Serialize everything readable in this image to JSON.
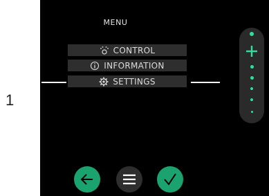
{
  "callout": {
    "number": "1"
  },
  "menu": {
    "title": "MENU",
    "items": [
      {
        "label": "CONTROL",
        "icon": "control-icon"
      },
      {
        "label": "INFORMATION",
        "icon": "info-icon"
      },
      {
        "label": "SETTINGS",
        "icon": "gear-icon",
        "selected": true
      }
    ]
  },
  "side_control": {
    "icons": [
      "dot-icon",
      "plus-icon",
      "dot-icon",
      "dot-icon",
      "dot-icon",
      "dot-icon",
      "dot-icon"
    ]
  },
  "bottom_buttons": [
    {
      "icon": "arrow-left-icon"
    },
    {
      "icon": "hamburger-icon"
    },
    {
      "icon": "checkmark-icon"
    }
  ],
  "colors": {
    "accent": "#1aa36e",
    "screen": "#000000",
    "item_bg": "#2e2e2e"
  }
}
